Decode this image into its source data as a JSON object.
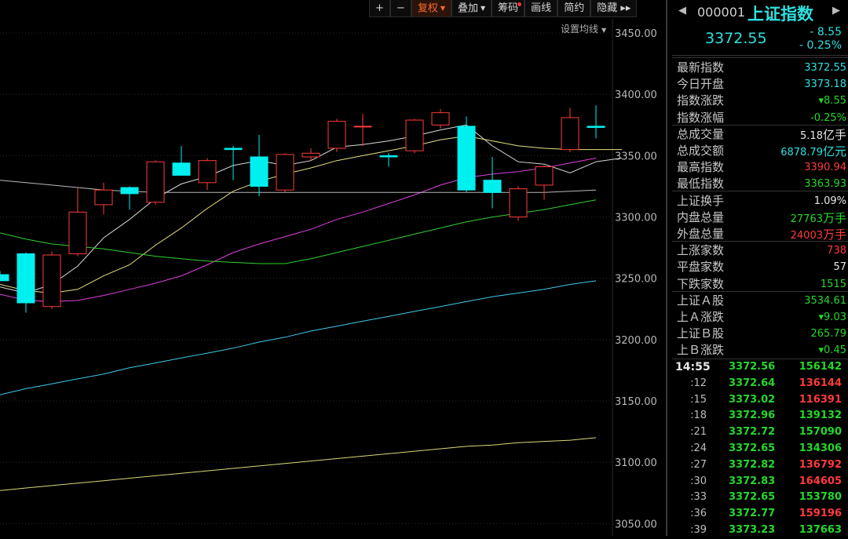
{
  "toolbar": {
    "plus": "+",
    "minus": "−",
    "fuquan": "复权",
    "diejia": "叠加",
    "chouma": "筹码",
    "huaxian": "画线",
    "jianyue": "简约",
    "yincang": "隐藏",
    "more": "▸▸"
  },
  "set_ma_label": "设置均线",
  "panel": {
    "code": "000001",
    "name": "上证指数",
    "price": "3372.55",
    "change": "- 8.55",
    "change_pct": "- 0.25%",
    "info": [
      {
        "label": "最新指数",
        "value": "3372.55",
        "unit": "",
        "color": "c-cyan"
      },
      {
        "label": "今日开盘",
        "value": "3373.18",
        "unit": "",
        "color": "c-cyan"
      },
      {
        "label": "指数涨跌",
        "value": "▾8.55",
        "unit": "",
        "color": "c-green"
      },
      {
        "label": "指数涨幅",
        "value": "-0.25%",
        "unit": "",
        "color": "c-green"
      },
      {
        "label": "总成交量",
        "value": "5.18",
        "unit": "亿手",
        "color": "c-white"
      },
      {
        "label": "总成交额",
        "value": "6878.79",
        "unit": "亿元",
        "color": "c-cyan"
      },
      {
        "label": "最高指数",
        "value": "3390.94",
        "unit": "",
        "color": "c-red"
      },
      {
        "label": "最低指数",
        "value": "3363.93",
        "unit": "",
        "color": "c-green"
      },
      {
        "label": "上证换手",
        "value": "1.09%",
        "unit": "",
        "color": "c-white"
      },
      {
        "label": "内盘总量",
        "value": "27763",
        "unit": "万手",
        "color": "c-green"
      },
      {
        "label": "外盘总量",
        "value": "24003",
        "unit": "万手",
        "color": "c-red"
      },
      {
        "label": "上涨家数",
        "value": "738",
        "unit": "",
        "color": "c-red"
      },
      {
        "label": "平盘家数",
        "value": "57",
        "unit": "",
        "color": "c-white"
      },
      {
        "label": "下跌家数",
        "value": "1515",
        "unit": "",
        "color": "c-green"
      },
      {
        "label": "上证Ａ股",
        "value": "3534.61",
        "unit": "",
        "color": "c-green"
      },
      {
        "label": "上Ａ涨跌",
        "value": "▾9.03",
        "unit": "",
        "color": "c-green"
      },
      {
        "label": "上证Ｂ股",
        "value": "265.79",
        "unit": "",
        "color": "c-green"
      },
      {
        "label": "上Ｂ涨跌",
        "value": "▾0.45",
        "unit": "",
        "color": "c-green"
      }
    ],
    "ticks": [
      {
        "time": "14:55",
        "price": "3372.56",
        "vol": "156142",
        "color": "c-green"
      },
      {
        "time": ":12",
        "price": "3372.64",
        "vol": "136144",
        "color": "c-red"
      },
      {
        "time": ":15",
        "price": "3373.02",
        "vol": "116391",
        "color": "c-red"
      },
      {
        "time": ":18",
        "price": "3372.96",
        "vol": "139132",
        "color": "c-green"
      },
      {
        "time": ":21",
        "price": "3372.72",
        "vol": "157090",
        "color": "c-green"
      },
      {
        "time": ":24",
        "price": "3372.65",
        "vol": "134306",
        "color": "c-green"
      },
      {
        "time": ":27",
        "price": "3372.82",
        "vol": "136792",
        "color": "c-red"
      },
      {
        "time": ":30",
        "price": "3372.83",
        "vol": "164605",
        "color": "c-red"
      },
      {
        "time": ":33",
        "price": "3372.65",
        "vol": "153780",
        "color": "c-green"
      },
      {
        "time": ":36",
        "price": "3372.77",
        "vol": "159196",
        "color": "c-red"
      },
      {
        "time": ":39",
        "price": "3373.23",
        "vol": "137663",
        "color": "c-green"
      }
    ]
  },
  "chart_data": {
    "type": "candlestick",
    "ylim": [
      3040,
      3475
    ],
    "y_ticks": [
      3450,
      3400,
      3350,
      3300,
      3250,
      3200,
      3150,
      3100,
      3050
    ],
    "y_tick_labels": [
      "3450.00",
      "3400.00",
      "3350.00",
      "3300.00",
      "3250.00",
      "3200.00",
      "3150.00",
      "3100.00",
      "3050.00"
    ],
    "up_color": "#ff3b3b",
    "down_color": "#00f0f0",
    "candles": [
      {
        "o": 3253,
        "h": 3256,
        "l": 3248,
        "c": 3248
      },
      {
        "o": 3270,
        "h": 3271,
        "l": 3222,
        "c": 3230
      },
      {
        "o": 3227,
        "h": 3272,
        "l": 3225,
        "c": 3269
      },
      {
        "o": 3270,
        "h": 3324,
        "l": 3268,
        "c": 3304
      },
      {
        "o": 3310,
        "h": 3328,
        "l": 3302,
        "c": 3322
      },
      {
        "o": 3324,
        "h": 3325,
        "l": 3306,
        "c": 3319
      },
      {
        "o": 3312,
        "h": 3346,
        "l": 3310,
        "c": 3345
      },
      {
        "o": 3344,
        "h": 3358,
        "l": 3334,
        "c": 3334
      },
      {
        "o": 3328,
        "h": 3348,
        "l": 3322,
        "c": 3346
      },
      {
        "o": 3356,
        "h": 3358,
        "l": 3330,
        "c": 3355
      },
      {
        "o": 3349,
        "h": 3367,
        "l": 3317,
        "c": 3325
      },
      {
        "o": 3322,
        "h": 3352,
        "l": 3320,
        "c": 3351
      },
      {
        "o": 3349,
        "h": 3356,
        "l": 3346,
        "c": 3352
      },
      {
        "o": 3356,
        "h": 3380,
        "l": 3353,
        "c": 3378
      },
      {
        "o": 3374,
        "h": 3384,
        "l": 3358,
        "c": 3374
      },
      {
        "o": 3350,
        "h": 3352,
        "l": 3341,
        "c": 3349
      },
      {
        "o": 3354,
        "h": 3380,
        "l": 3352,
        "c": 3379
      },
      {
        "o": 3375,
        "h": 3388,
        "l": 3372,
        "c": 3385
      },
      {
        "o": 3374,
        "h": 3382,
        "l": 3320,
        "c": 3322
      },
      {
        "o": 3330,
        "h": 3349,
        "l": 3307,
        "c": 3320
      },
      {
        "o": 3300,
        "h": 3325,
        "l": 3297,
        "c": 3323
      },
      {
        "o": 3326,
        "h": 3342,
        "l": 3314,
        "c": 3341
      },
      {
        "o": 3355,
        "h": 3389,
        "l": 3353,
        "c": 3381
      },
      {
        "o": 3374,
        "h": 3391,
        "l": 3364,
        "c": 3373
      }
    ],
    "ma_lines": [
      {
        "color": "#d8d8d8",
        "values": [
          3243,
          3238,
          3245,
          3260,
          3283,
          3298,
          3315,
          3327,
          3333,
          3342,
          3346,
          3342,
          3346,
          3357,
          3359,
          3362,
          3366,
          3371,
          3375,
          3358,
          3345,
          3343,
          3336,
          3345,
          3348
        ]
      },
      {
        "color": "#e8e080",
        "values": [
          3245,
          3240,
          3238,
          3241,
          3252,
          3261,
          3277,
          3291,
          3307,
          3321,
          3329,
          3335,
          3340,
          3346,
          3350,
          3354,
          3358,
          3363,
          3366,
          3362,
          3358,
          3356,
          3355,
          3355,
          3355
        ]
      },
      {
        "color": "#e040e0",
        "values": [
          3237,
          3232,
          3231,
          3232,
          3236,
          3241,
          3246,
          3252,
          3261,
          3271,
          3278,
          3284,
          3290,
          3298,
          3304,
          3311,
          3318,
          3326,
          3332,
          3335,
          3337,
          3340,
          3344,
          3348
        ]
      },
      {
        "color": "#30d030",
        "values": [
          3287,
          3282,
          3278,
          3276,
          3274,
          3271,
          3268,
          3266,
          3264,
          3263,
          3262,
          3262,
          3266,
          3271,
          3276,
          3281,
          3286,
          3291,
          3296,
          3300,
          3303,
          3306,
          3310,
          3314
        ]
      },
      {
        "color": "#b8b8b8",
        "values": [
          3330,
          3328,
          3326,
          3324,
          3322,
          3321,
          3320,
          3320,
          3320,
          3320,
          3320,
          3320,
          3320,
          3320,
          3320,
          3320,
          3320,
          3320,
          3320,
          3320,
          3320,
          3320,
          3321,
          3322
        ]
      },
      {
        "color": "#40c8e8",
        "values": [
          3155,
          3160,
          3164,
          3168,
          3172,
          3177,
          3181,
          3185,
          3189,
          3193,
          3198,
          3202,
          3207,
          3211,
          3215,
          3219,
          3223,
          3227,
          3231,
          3235,
          3238,
          3241,
          3245,
          3248
        ]
      },
      {
        "color": "#d8d878",
        "values": [
          3077,
          3079,
          3081,
          3083,
          3085,
          3087,
          3089,
          3091,
          3093,
          3095,
          3097,
          3099,
          3101,
          3103,
          3105,
          3107,
          3109,
          3111,
          3113,
          3114,
          3116,
          3117,
          3118,
          3120
        ]
      }
    ]
  }
}
